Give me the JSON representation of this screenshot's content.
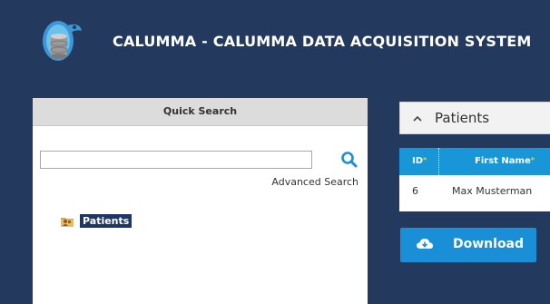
{
  "header": {
    "app_title": "CALUMMA - CALUMMA DATA ACQUISITION SYSTEM"
  },
  "quick_search": {
    "title": "Quick Search",
    "search_value": "",
    "search_placeholder": "",
    "advanced_link": "Advanced Search"
  },
  "tree": {
    "items": [
      {
        "label": "Patients",
        "icon": "folder-people-icon"
      }
    ]
  },
  "patients_panel": {
    "title": "Patients",
    "collapse_icon": "chevron-up-icon"
  },
  "table": {
    "columns": [
      {
        "label": "ID",
        "sortable_marker": "*"
      },
      {
        "label": "First Name",
        "sortable_marker": "*"
      }
    ],
    "rows": [
      {
        "id": "6",
        "first_name": "Max Musterman"
      }
    ]
  },
  "download": {
    "label": "Download",
    "icon": "cloud-download-icon"
  },
  "colors": {
    "background": "#233a5e",
    "accent": "#1b8ed8",
    "grid_header": "#1996d8",
    "tree_selected": "#1f3564"
  }
}
